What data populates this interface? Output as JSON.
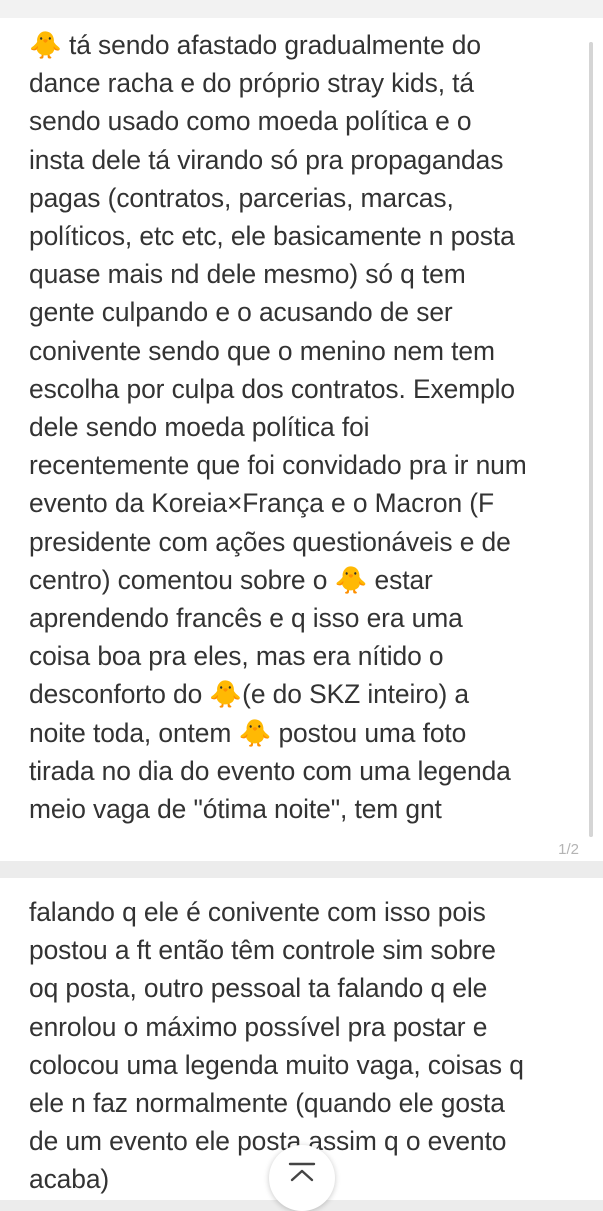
{
  "post": {
    "part1_text": "🐥 tá sendo afastado gradualmente do\ndance racha e do próprio stray kids, tá\nsendo usado como moeda política e o\ninsta dele tá virando só pra propagandas\npagas (contratos, parcerias, marcas,\npolíticos, etc etc, ele basicamente n posta\nquase mais nd dele mesmo) só q tem\ngente culpando e o acusando de ser\nconivente sendo que o menino nem tem\nescolha por culpa dos contratos. Exemplo\ndele sendo moeda política foi\nrecentemente que foi convidado pra ir num\nevento da Koreia×França e o Macron (F\npresidente com ações questionáveis e de\ncentro) comentou sobre o 🐥 estar\naprendendo francês e q isso era uma\ncoisa boa pra eles, mas era nítido o\ndesconforto do 🐥(e do SKZ inteiro) a\nnoite toda, ontem 🐥 postou uma foto\ntirada no dia do evento com uma legenda\nmeio vaga de \"ótima noite\", tem gnt",
    "page_indicator": "1/2",
    "part2_text": "falando q ele é conivente com isso pois\npostou a ft então têm controle sim sobre\noq posta, outro pessoal ta falando q ele\nenrolou o máximo possível pra postar e\ncolocou uma legenda muito vaga, coisas q\nele n faz normalmente (quando ele gosta\nde um evento ele posta assim q o evento\nacaba)"
  },
  "icons": {
    "scroll_to_top": "chevron-up-to-top-icon",
    "chick": "baby-chick-emoji"
  },
  "colors": {
    "background": "#ececec",
    "card": "#ffffff",
    "text": "#333333",
    "muted": "#b4b4b4"
  }
}
